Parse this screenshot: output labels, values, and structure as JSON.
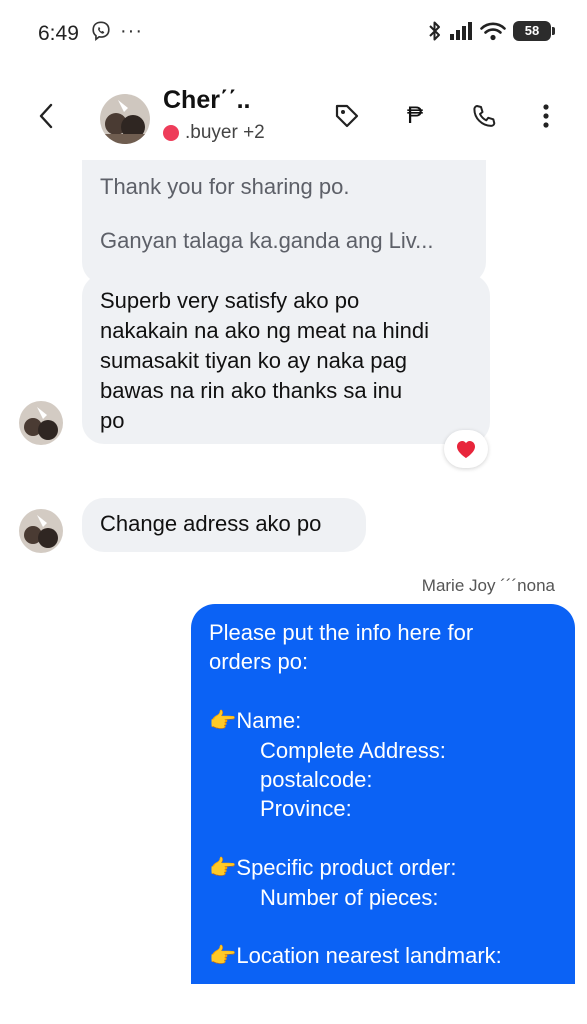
{
  "status_bar": {
    "time": "6:49",
    "more": "···",
    "battery": "58"
  },
  "header": {
    "contact_name": "Cher΄΄..",
    "contact_sub": ".buyer +2",
    "price_icon": "₱",
    "icons": [
      "back-icon",
      "tag-icon",
      "peso-icon",
      "phone-icon",
      "more-vert-icon"
    ]
  },
  "messages": {
    "m1_lines": [
      "Thank you for sharing po.",
      "",
      "Ganyan talaga ka.ganda ang Liv..."
    ],
    "m2_lines": [
      "Superb very satisfy ako po",
      "nakakain na ako ng meat na hindi",
      "sumasakit tiyan ko ay naka pag",
      "bawas na rin ako thanks sa inu",
      "po"
    ],
    "m2_reaction": "❤",
    "m3": "Change adress ako po",
    "out_sender": "Marie Joy ´´´nona",
    "out_lines": [
      "Please  put the info here for",
      "orders po:",
      "",
      "👉Name:",
      "Complete Address:",
      "postalcode:",
      "Province:",
      "",
      "👉Specific product order:",
      "Number of pieces:",
      "",
      "👉Location nearest landmark:"
    ]
  },
  "colors": {
    "outgoing_bubble": "#0b62f5",
    "incoming_bubble": "#eff1f4",
    "status_dot": "#ee3d5a",
    "reaction_heart": "#e8253b"
  }
}
